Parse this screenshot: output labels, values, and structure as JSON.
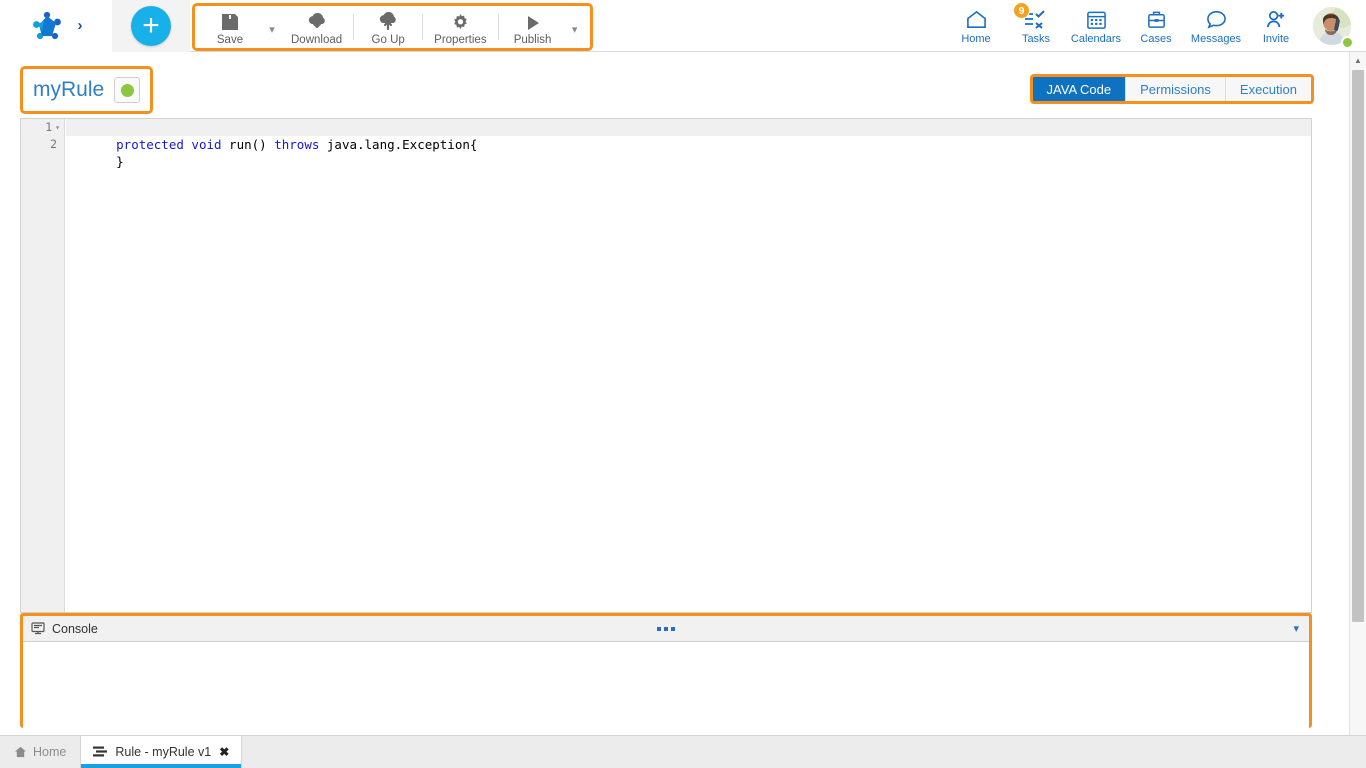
{
  "header": {
    "logo_name": "bonita-logo",
    "expand_label": "›",
    "add_button_label": "+",
    "toolbar": {
      "items": [
        {
          "label": "Save",
          "icon": "save-floppy-icon",
          "has_caret": true
        },
        {
          "label": "Download",
          "icon": "cloud-download-icon",
          "has_caret": false
        },
        {
          "label": "Go Up",
          "icon": "cloud-upload-icon",
          "has_caret": false
        },
        {
          "label": "Properties",
          "icon": "gear-icon",
          "has_caret": false
        },
        {
          "label": "Publish",
          "icon": "play-icon",
          "has_caret": true
        }
      ]
    },
    "nav": [
      {
        "label": "Home",
        "icon": "home-icon",
        "badge": ""
      },
      {
        "label": "Tasks",
        "icon": "tasks-checklist-icon",
        "badge": "9"
      },
      {
        "label": "Calendars",
        "icon": "calendar-icon",
        "badge": ""
      },
      {
        "label": "Cases",
        "icon": "briefcase-icon",
        "badge": ""
      },
      {
        "label": "Messages",
        "icon": "speech-bubble-icon",
        "badge": ""
      },
      {
        "label": "Invite",
        "icon": "add-user-icon",
        "badge": ""
      }
    ],
    "avatar": {
      "name": "user-avatar",
      "status": "online"
    }
  },
  "document": {
    "title": "myRule",
    "status_color": "#8dc63f",
    "tabs": [
      {
        "label": "JAVA Code",
        "active": true
      },
      {
        "label": "Permissions",
        "active": false
      },
      {
        "label": "Execution",
        "active": false
      }
    ]
  },
  "editor": {
    "lines": [
      {
        "number": "1",
        "fold": "▾",
        "highlight": true,
        "tokens": [
          {
            "text": "protected",
            "type": "kw"
          },
          {
            "text": " ",
            "type": "pl"
          },
          {
            "text": "void",
            "type": "kw"
          },
          {
            "text": " run() ",
            "type": "pl"
          },
          {
            "text": "throws",
            "type": "kw"
          },
          {
            "text": " java.lang.Exception{",
            "type": "pl"
          }
        ]
      },
      {
        "number": "2",
        "fold": "",
        "highlight": false,
        "tokens": [
          {
            "text": "}",
            "type": "pl"
          }
        ]
      }
    ]
  },
  "console": {
    "title": "Console",
    "icon": "console-monitor-icon",
    "grip": "drag-handle-dots",
    "collapse_icon": "chevron-down-icon",
    "content": ""
  },
  "taskbar": {
    "home_label": "Home",
    "home_icon": "home-icon",
    "tabs": [
      {
        "label": "Rule - myRule v1",
        "icon": "rule-icon",
        "close": "✖",
        "active": true
      }
    ]
  },
  "colors": {
    "accent_orange": "#f5901e",
    "brand_blue": "#1b6fc2",
    "tab_active": "#0f72c0",
    "cyan": "#18b0e8",
    "status_green": "#8dc63f"
  }
}
